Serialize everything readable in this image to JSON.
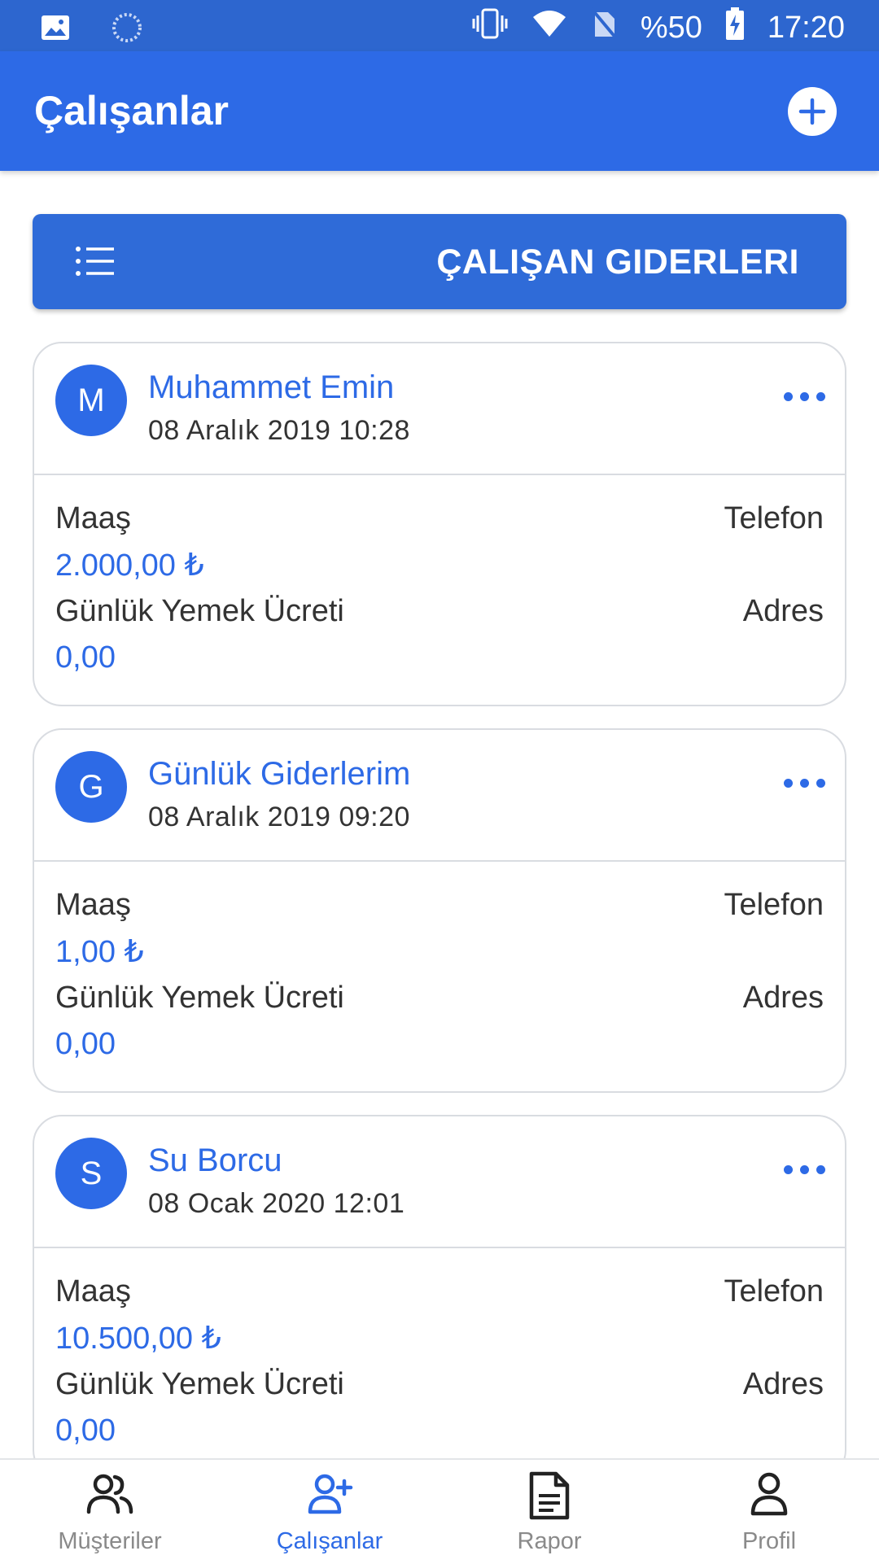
{
  "status_bar": {
    "battery": "%50",
    "time": "17:20",
    "icons": [
      "image-icon",
      "sync-icon",
      "vibrate-icon",
      "wifi-icon",
      "no-sim-icon",
      "battery-charging-icon"
    ]
  },
  "app_bar": {
    "title": "Çalışanlar",
    "add_icon": "plus-circle-icon"
  },
  "expenses_button": {
    "label": "ÇALIŞAN GIDERLERI",
    "icon": "list-icon"
  },
  "employees": [
    {
      "initial": "M",
      "name": "Muhammet Emin",
      "date": "08 Aralık 2019  10:28",
      "salary_label": "Maaş",
      "salary": "2.000,00 ₺",
      "meal_label": "Günlük Yemek Ücreti",
      "meal": "0,00",
      "phone_label": "Telefon",
      "address_label": "Adres"
    },
    {
      "initial": "G",
      "name": "Günlük Giderlerim",
      "date": "08 Aralık 2019  09:20",
      "salary_label": "Maaş",
      "salary": "1,00 ₺",
      "meal_label": "Günlük Yemek Ücreti",
      "meal": "0,00",
      "phone_label": "Telefon",
      "address_label": "Adres"
    },
    {
      "initial": "S",
      "name": "Su Borcu",
      "date": "08 Ocak 2020  12:01",
      "salary_label": "Maaş",
      "salary": "10.500,00 ₺",
      "meal_label": "Günlük Yemek Ücreti",
      "meal": "0,00",
      "phone_label": "Telefon",
      "address_label": "Adres"
    }
  ],
  "bottom_nav": {
    "items": [
      {
        "label": "Müşteriler",
        "icon": "users-icon"
      },
      {
        "label": "Çalışanlar",
        "icon": "user-plus-icon"
      },
      {
        "label": "Rapor",
        "icon": "document-icon"
      },
      {
        "label": "Profil",
        "icon": "user-icon"
      }
    ],
    "active": "Çalışanlar"
  },
  "colors": {
    "primary": "#2d6ae6",
    "status_bar": "#2d66cf",
    "text": "#333333",
    "muted": "#8a8a8a"
  }
}
